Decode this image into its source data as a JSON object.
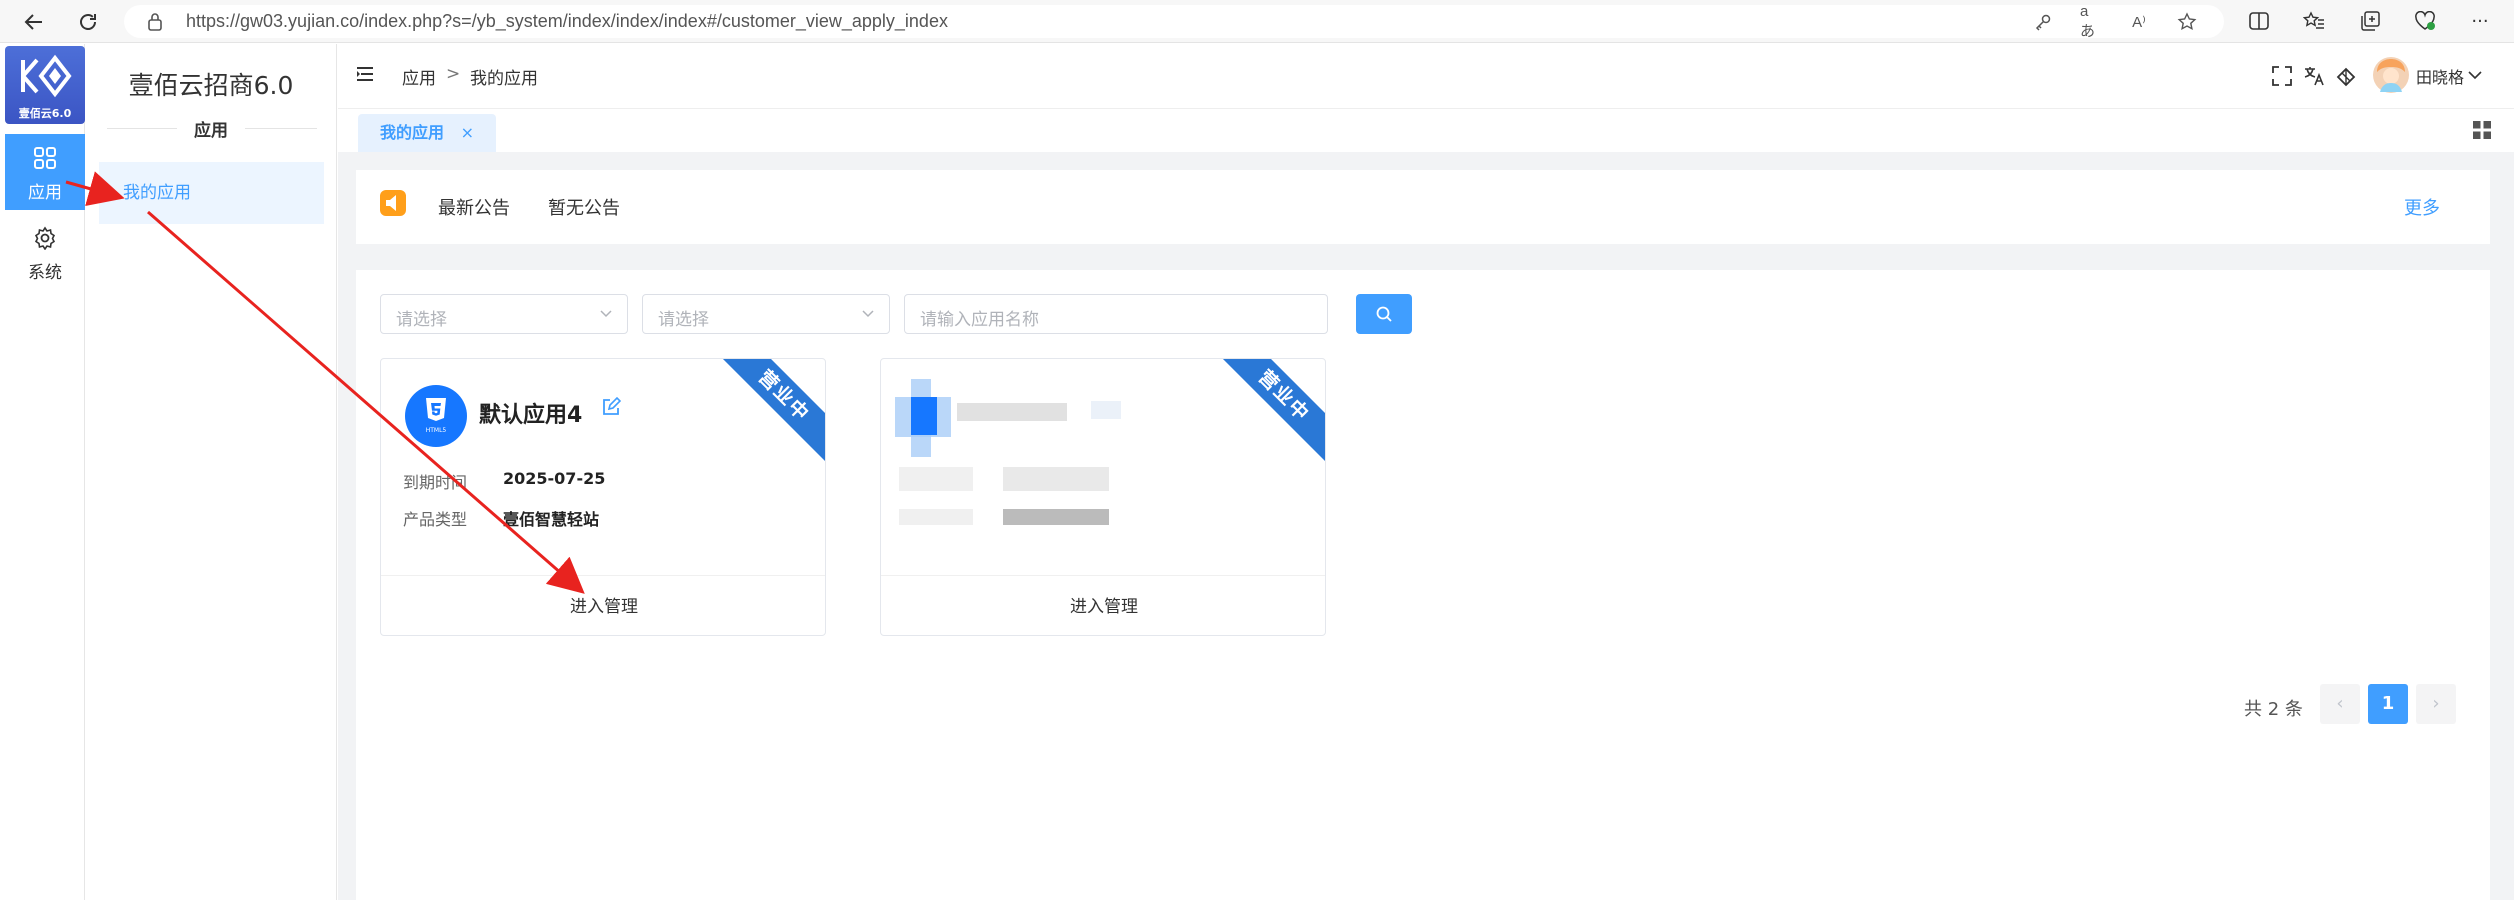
{
  "browser": {
    "url": "https://gw03.yujian.co/index.php?s=/yb_system/index/index/index#/customer_view_apply_index",
    "icons": [
      "back-icon",
      "refresh-icon",
      "lock-icon",
      "key-icon",
      "translate-icon",
      "read-aloud-icon",
      "favorite-star-icon",
      "split-screen-icon",
      "favorites-icon",
      "collections-icon",
      "performance-icon",
      "more-icon"
    ],
    "translate_glyph": "aあ",
    "read_aloud_glyph": "A⁾",
    "more_glyph": "···"
  },
  "rail": {
    "logo_text": "壹佰云6.0",
    "items": [
      {
        "label": "应用",
        "icon": "grid-icon",
        "active": true
      },
      {
        "label": "系统",
        "icon": "gear-icon",
        "active": false
      }
    ]
  },
  "subnav": {
    "title": "壹佰云招商6.0",
    "group": "应用",
    "items": [
      {
        "label": "我的应用",
        "active": true
      }
    ]
  },
  "header": {
    "breadcrumb": [
      "应用",
      ">",
      "我的应用"
    ],
    "user_name": "田晓格",
    "icons": [
      "hamburger-icon",
      "fullscreen-icon",
      "translate-icon",
      "theme-icon",
      "avatar",
      "chevron-down-icon"
    ]
  },
  "tabs": [
    {
      "label": "我的应用",
      "close": "×"
    }
  ],
  "notice": {
    "title": "最新公告",
    "text": "暂无公告",
    "more": "更多"
  },
  "filters": {
    "select1_placeholder": "请选择",
    "select2_placeholder": "请选择",
    "search_placeholder": "请输入应用名称"
  },
  "cards": [
    {
      "name": "默认应用4",
      "ribbon": "营业中",
      "expire_label": "到期时间",
      "expire_value": "2025-07-25",
      "type_label": "产品类型",
      "type_value": "壹佰智慧轻站",
      "action": "进入管理",
      "logo_caption": "HTML5"
    },
    {
      "name": "",
      "ribbon": "营业中",
      "action": "进入管理"
    }
  ],
  "pagination": {
    "total_text": "共 2 条",
    "prev": "‹",
    "current": "1",
    "next": "›"
  },
  "colors": {
    "accent": "#409eff",
    "ribbon": "#2a78d6",
    "annotation_arrow": "#e8231f",
    "notice_icon": "#ff9f1a"
  }
}
